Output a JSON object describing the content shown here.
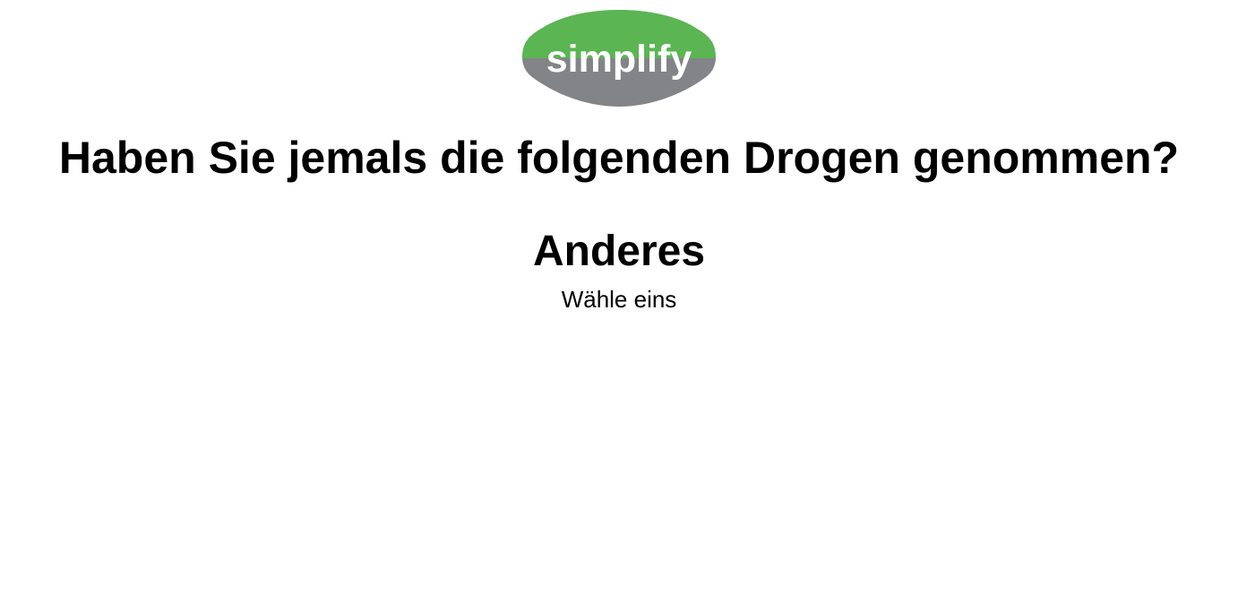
{
  "logo": {
    "text": "simplify",
    "icon": "simplify-logo",
    "colors": {
      "top": "#5ab552",
      "bottom": "#838487",
      "text": "#ffffff"
    }
  },
  "question": {
    "title": "Haben Sie jemals die folgenden Drogen genommen?"
  },
  "option": {
    "title": "Anderes",
    "instruction": "Wähle eins"
  }
}
